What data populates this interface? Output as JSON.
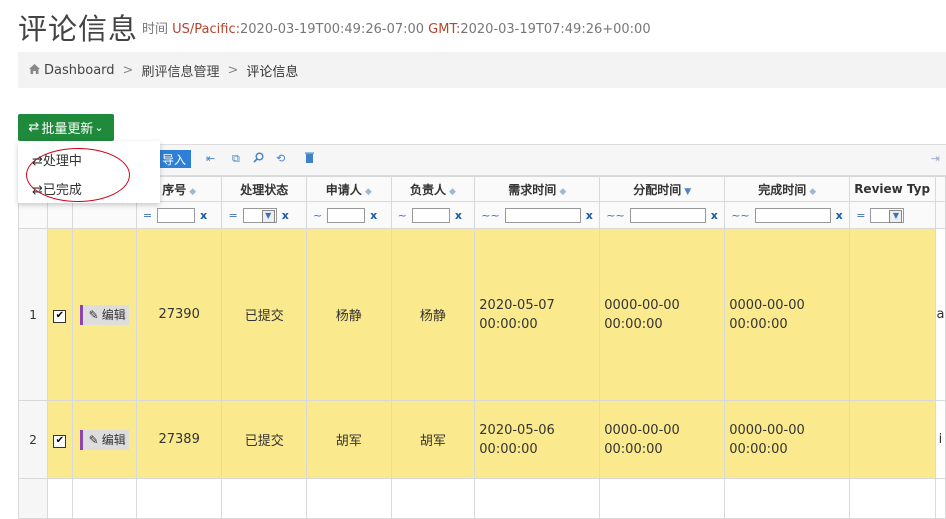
{
  "header": {
    "title": "评论信息",
    "time_label": "时间",
    "timezone": "US/Pacific:",
    "local_time": "2020-03-19T00:49:26-07:00",
    "gmt_label": "GMT:",
    "gmt_time": "2020-03-19T07:49:26+00:00"
  },
  "breadcrumb": {
    "home_icon": "home-icon",
    "items": [
      "Dashboard",
      "刷评信息管理",
      "评论信息"
    ],
    "separator": ">"
  },
  "batch": {
    "label": "批量更新",
    "icon": "exchange-icon",
    "caret": "⌄",
    "menu": [
      "处理中",
      "已完成"
    ]
  },
  "toolbar": {
    "import_label": "导入",
    "icons": [
      "first-page-icon",
      "copy-icon",
      "search-icon",
      "refresh-icon",
      "delete-icon"
    ]
  },
  "grid": {
    "columns": [
      "序号",
      "处理状态",
      "申请人",
      "负责人",
      "需求时间",
      "分配时间",
      "完成时间",
      "Review Typ"
    ],
    "filter_ops": [
      "=",
      "=",
      "~",
      "~",
      "~~",
      "~~",
      "~~",
      "="
    ],
    "filter_clear": "x",
    "edit_label": "编辑",
    "rows": [
      {
        "num": "1",
        "checked": "✔",
        "id": "27390",
        "status": "已提交",
        "applicant": "杨静",
        "owner": "杨静",
        "need_time": "2020-05-07 00:00:00",
        "assign_time": "0000-00-00 00:00:00",
        "done_time": "0000-00-00 00:00:00",
        "review_type": "",
        "extra": "a"
      },
      {
        "num": "2",
        "checked": "✔",
        "id": "27389",
        "status": "已提交",
        "applicant": "胡军",
        "owner": "胡军",
        "need_time": "2020-05-06 00:00:00",
        "assign_time": "0000-00-00 00:00:00",
        "done_time": "0000-00-00 00:00:00",
        "review_type": "",
        "extra": "i"
      }
    ]
  },
  "colors": {
    "accent_green": "#1f8a3b",
    "row_highlight": "#fbe98d",
    "import_blue": "#2e7fd8",
    "annotation_red": "#d0021b"
  }
}
